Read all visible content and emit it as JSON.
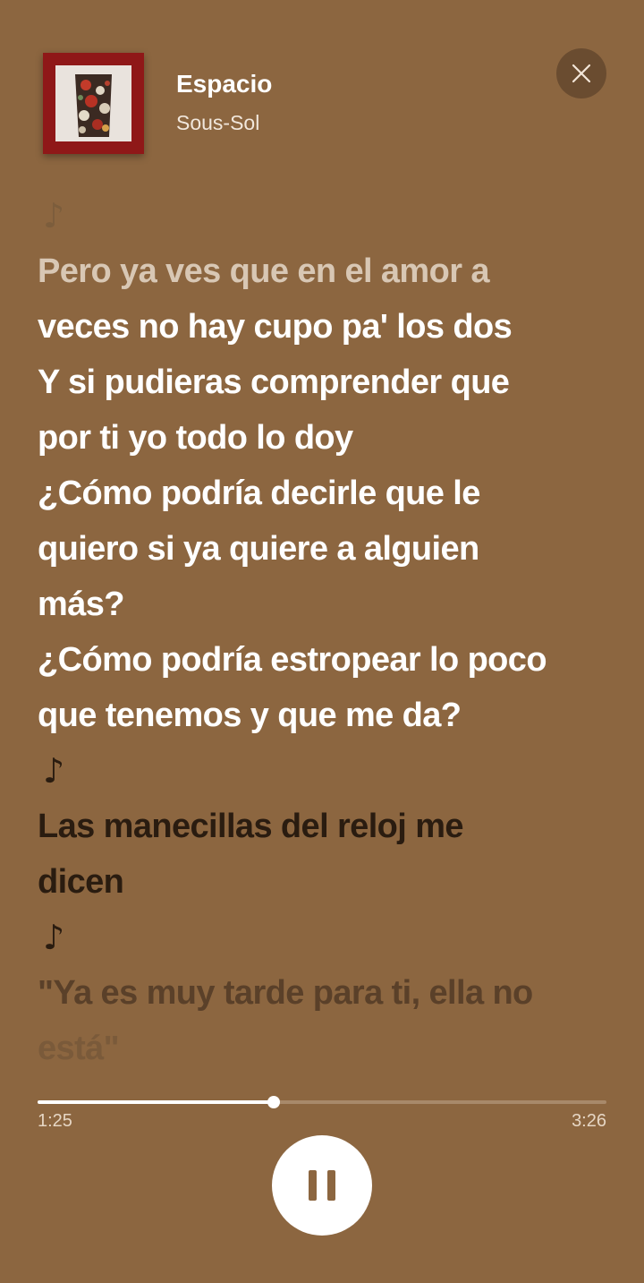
{
  "track": {
    "title": "Espacio",
    "artist": "Sous-Sol"
  },
  "icons": {
    "close": "close-icon",
    "note": "music-note-icon",
    "pause": "pause-icon"
  },
  "lyrics": [
    {
      "type": "note",
      "text": "♪",
      "style": "note-light"
    },
    {
      "type": "line",
      "text": "Pero ya ves que en el amor a",
      "style": "fading"
    },
    {
      "type": "line",
      "text": "veces no hay cupo pa' los dos",
      "style": "past"
    },
    {
      "type": "line",
      "text": "Y si pudieras comprender que",
      "style": "past"
    },
    {
      "type": "line",
      "text": "por ti yo todo lo doy",
      "style": "past"
    },
    {
      "type": "line",
      "text": "¿Cómo podría decirle que le",
      "style": "past"
    },
    {
      "type": "line",
      "text": "quiero si ya quiere a alguien",
      "style": "past"
    },
    {
      "type": "line",
      "text": "más?",
      "style": "past"
    },
    {
      "type": "line",
      "text": "¿Cómo podría estropear lo poco",
      "style": "past"
    },
    {
      "type": "line",
      "text": "que tenemos y que me da?",
      "style": "past"
    },
    {
      "type": "note",
      "text": "♪",
      "style": "note-dark"
    },
    {
      "type": "line",
      "text": "Las manecillas del reloj me",
      "style": "current-dark"
    },
    {
      "type": "line",
      "text": "dicen",
      "style": "current-dark"
    },
    {
      "type": "note",
      "text": "♪",
      "style": "note-dark"
    },
    {
      "type": "line",
      "text": "\"Ya es muy tarde para ti, ella no",
      "style": "faded-dark"
    },
    {
      "type": "line",
      "text": "está\"",
      "style": "faded-more"
    }
  ],
  "playback": {
    "elapsed": "1:25",
    "total": "3:26",
    "progress_fraction": 0.415
  },
  "colors": {
    "background": "#8c6640",
    "accent": "#ffffff"
  }
}
